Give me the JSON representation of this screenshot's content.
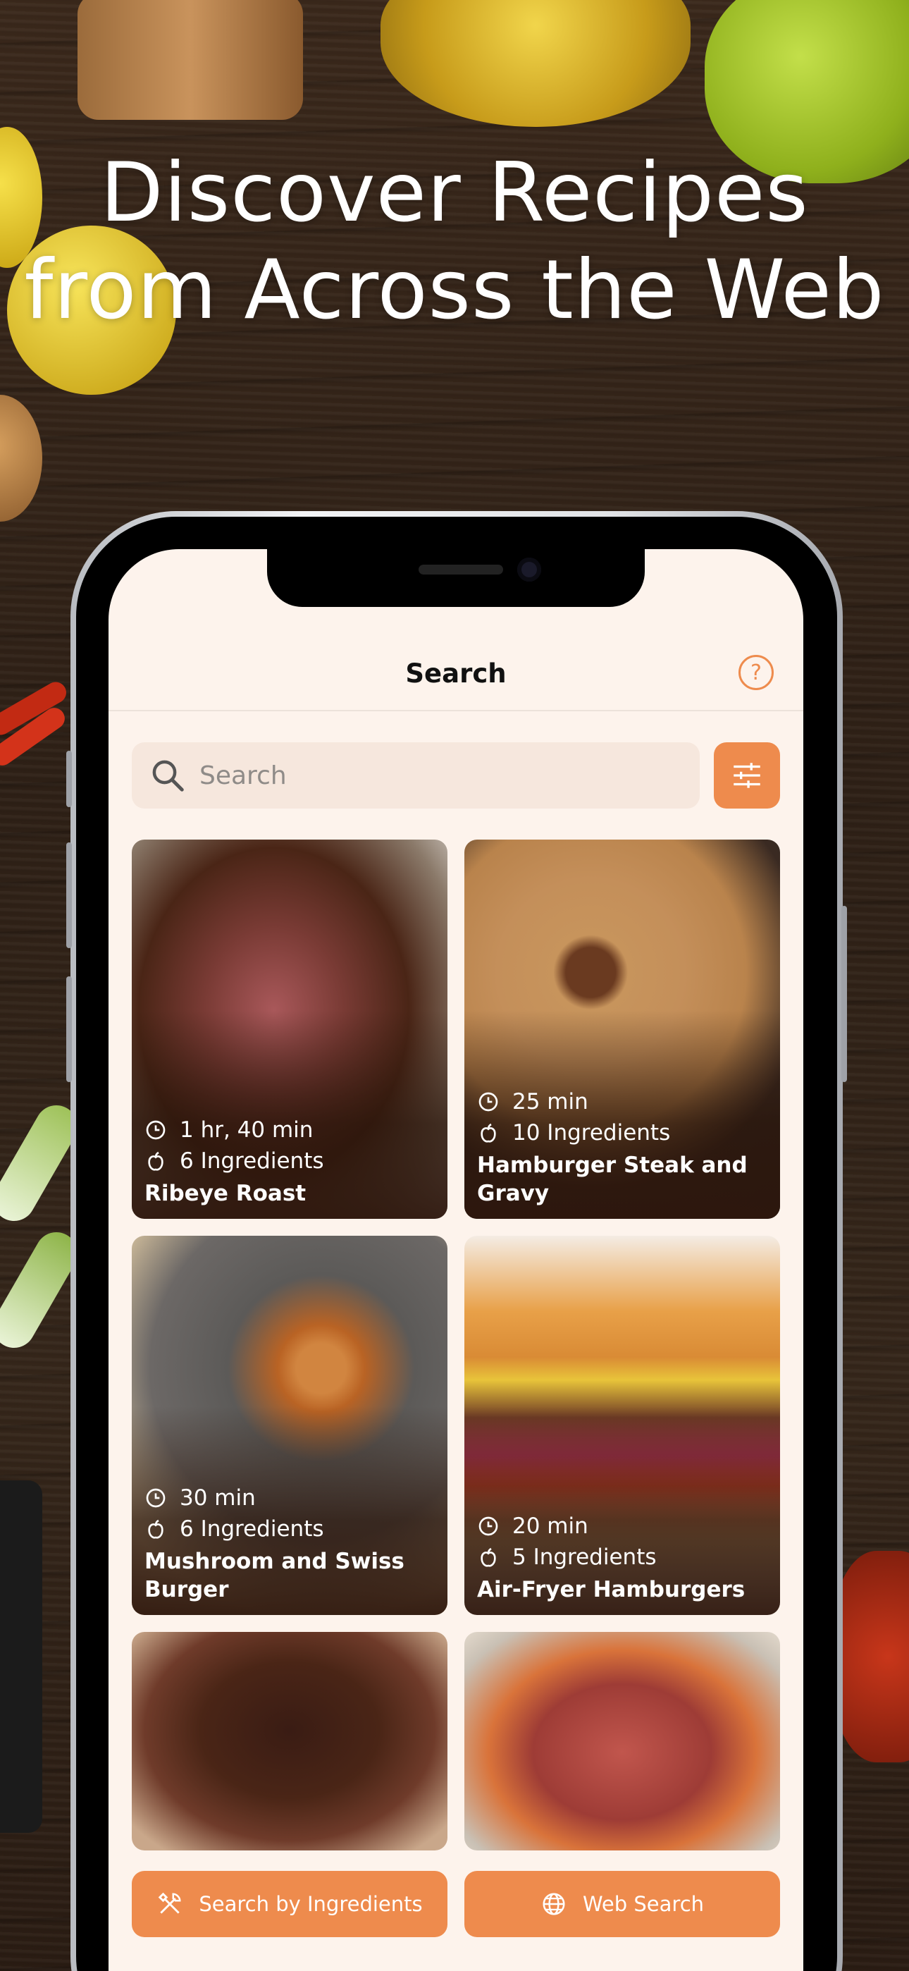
{
  "headline": "Discover Recipes from Across the Web",
  "nav": {
    "title": "Search",
    "help_icon": "?"
  },
  "search": {
    "placeholder": "Search"
  },
  "recipes": [
    {
      "time": "1 hr, 40 min",
      "ingredients": "6 Ingredients",
      "title": "Ribeye Roast"
    },
    {
      "time": "25 min",
      "ingredients": "10 Ingredients",
      "title": "Hamburger Steak and Gravy"
    },
    {
      "time": "30 min",
      "ingredients": "6 Ingredients",
      "title": "Mushroom and Swiss Burger"
    },
    {
      "time": "20 min",
      "ingredients": "5 Ingredients",
      "title": "Air-Fryer Hamburgers"
    }
  ],
  "bottom": {
    "ingredients_label": "Search by Ingredients",
    "web_label": "Web Search"
  },
  "colors": {
    "accent": "#ee8b4d",
    "screen_bg": "#fdf3ec"
  }
}
